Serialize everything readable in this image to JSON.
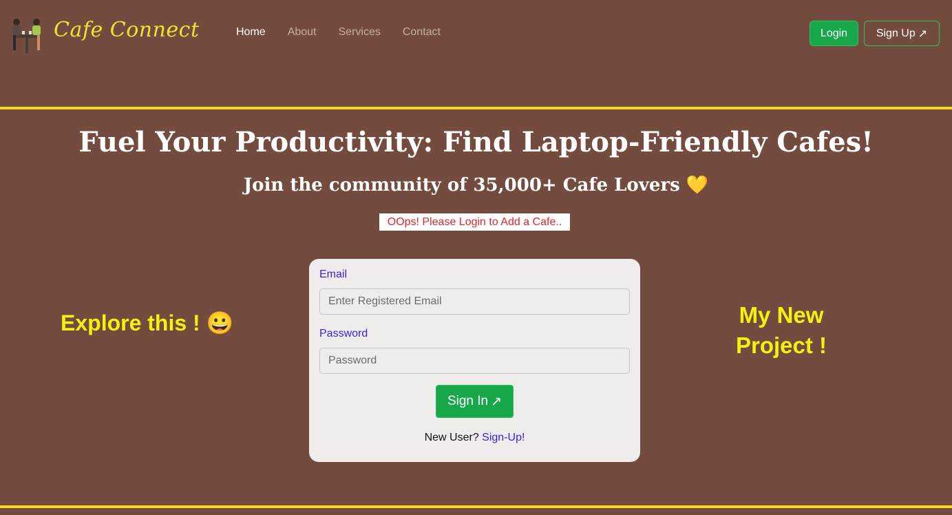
{
  "nav": {
    "brand": "Cafe Connect",
    "links": [
      "Home",
      "About",
      "Services",
      "Contact"
    ],
    "login_label": "Login",
    "signup_label": "Sign Up",
    "arrow": "↗"
  },
  "hero": {
    "title": "Fuel Your Productivity: Find Laptop-Friendly Cafes!",
    "subtitle": "Join the community of 35,000+ Cafe Lovers 💛",
    "alert": "OOps! Please Login to Add a Cafe.."
  },
  "sides": {
    "left": "Explore this ! 😀",
    "right_line1": "My New",
    "right_line2": "Project !"
  },
  "form": {
    "email_label": "Email",
    "email_placeholder": "Enter Registered Email",
    "password_label": "Password",
    "password_placeholder": "Password",
    "submit_label": "Sign In",
    "submit_arrow": "↗",
    "new_user_text": "New User?",
    "signup_link": "Sign-Up!"
  },
  "colors": {
    "background": "#744c3f",
    "accent_yellow": "#f8d61e",
    "button_green": "#18a84a",
    "alert_red": "#e0262d",
    "link_purple": "#3a1fd6"
  }
}
